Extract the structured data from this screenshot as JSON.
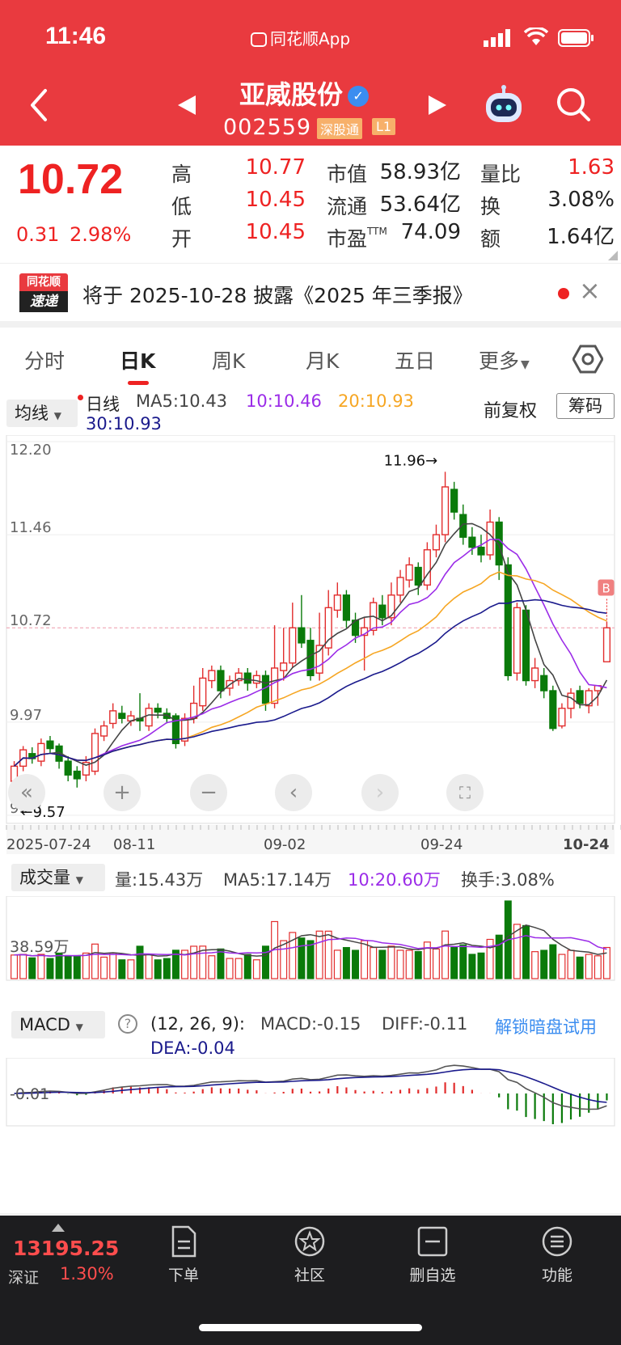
{
  "status": {
    "time": "11:46",
    "app": "同花顺App"
  },
  "stock": {
    "name": "亚威股份",
    "code": "002559",
    "badge1": "深股通",
    "badge2": "L1"
  },
  "quote": {
    "price": "10.72",
    "change": "0.31",
    "change_pct": "2.98%",
    "high_label": "高",
    "high": "10.77",
    "low_label": "低",
    "low": "10.45",
    "open_label": "开",
    "open": "10.45",
    "mcap_label": "市值",
    "mcap": "58.93亿",
    "float_label": "流通",
    "float": "53.64亿",
    "pe_label": "市盈",
    "pe_sup": "TTM",
    "pe": "74.09",
    "vr_label": "量比",
    "vr": "1.63",
    "turn_label": "换",
    "turn": "3.08%",
    "amt_label": "额",
    "amt": "1.64亿"
  },
  "notice": {
    "brand_top": "同花顺",
    "brand_bottom": "速递",
    "text": "将于 2025-10-28 披露《2025 年三季报》",
    "close": "×"
  },
  "tabs": [
    "分时",
    "日K",
    "周K",
    "月K",
    "五日",
    "更多"
  ],
  "kline": {
    "indicator": "均线",
    "period": "日线",
    "ma5": "MA5:10.43",
    "ma10": "10:10.46",
    "ma20": "20:10.93",
    "ma30": "30:10.93",
    "adjust": "前复权",
    "chips": "筹码",
    "y_labels": [
      "12.20",
      "11.46",
      "10.72",
      "9.97",
      "9.23"
    ],
    "high_mark": "11.96→",
    "low_mark": "←9.57",
    "buy_mark": "B",
    "x_labels": [
      "2025-07-24",
      "08-11",
      "09-02",
      "09-24",
      "10-24"
    ]
  },
  "volume": {
    "indicator": "成交量",
    "vol": "量:15.43万",
    "ma5": "MA5:17.14万",
    "ma10": "10:20.60万",
    "turnover": "换手:3.08%",
    "y_label": "38.59万"
  },
  "macd": {
    "indicator": "MACD",
    "help": "?",
    "params": "(12, 26, 9):",
    "macd": "MACD:-0.15",
    "diff": "DIFF:-0.11",
    "dea": "DEA:-0.04",
    "unlock": "解锁暗盘试用",
    "y_label": "-0.01"
  },
  "colors": {
    "up": "#e22d2d",
    "down": "#0a7a0a",
    "ma5": "#444444",
    "ma10": "#9b2ce8",
    "ma20": "#f6a623",
    "ma30": "#1a1a8c",
    "brand": "#e93a3f"
  },
  "bottom": {
    "index_value": "13195.25",
    "index_name": "深证",
    "index_pct": "1.30%",
    "nav": [
      "下单",
      "社区",
      "删自选",
      "功能"
    ]
  },
  "chart_data": {
    "type": "candlestick",
    "x_range": [
      "2025-07-24",
      "2025-10-24"
    ],
    "ylim": [
      9.23,
      12.2
    ],
    "annotations": {
      "high": 11.96,
      "low": 9.57
    },
    "candles": [
      [
        9.5,
        9.62,
        9.45,
        9.66
      ],
      [
        9.62,
        9.75,
        9.58,
        9.78
      ],
      [
        9.72,
        9.68,
        9.64,
        9.77
      ],
      [
        9.66,
        9.8,
        9.62,
        9.84
      ],
      [
        9.82,
        9.76,
        9.72,
        9.86
      ],
      [
        9.78,
        9.66,
        9.6,
        9.8
      ],
      [
        9.66,
        9.55,
        9.5,
        9.7
      ],
      [
        9.58,
        9.52,
        9.45,
        9.62
      ],
      [
        9.55,
        9.65,
        9.5,
        9.7
      ],
      [
        9.58,
        9.88,
        9.55,
        9.92
      ],
      [
        9.86,
        9.94,
        9.82,
        9.98
      ],
      [
        9.96,
        10.06,
        9.92,
        10.12
      ],
      [
        10.04,
        10.0,
        9.96,
        10.1
      ],
      [
        9.98,
        10.02,
        9.94,
        10.06
      ],
      [
        10.0,
        9.98,
        9.9,
        10.2
      ],
      [
        9.94,
        10.08,
        9.9,
        10.12
      ],
      [
        10.08,
        10.05,
        10.0,
        10.12
      ],
      [
        10.04,
        10.0,
        9.96,
        10.08
      ],
      [
        10.02,
        9.8,
        9.76,
        10.04
      ],
      [
        9.82,
        10.0,
        9.78,
        10.04
      ],
      [
        10.0,
        10.12,
        9.96,
        10.26
      ],
      [
        10.1,
        10.32,
        10.06,
        10.4
      ],
      [
        10.3,
        10.38,
        10.24,
        10.42
      ],
      [
        10.38,
        10.22,
        10.16,
        10.42
      ],
      [
        10.24,
        10.3,
        10.18,
        10.34
      ],
      [
        10.3,
        10.36,
        10.26,
        10.4
      ],
      [
        10.36,
        10.28,
        10.22,
        10.4
      ],
      [
        10.28,
        10.34,
        10.24,
        10.38
      ],
      [
        10.34,
        10.12,
        10.06,
        10.38
      ],
      [
        10.12,
        10.4,
        10.08,
        10.74
      ],
      [
        10.38,
        10.44,
        10.3,
        10.72
      ],
      [
        10.44,
        10.72,
        10.4,
        10.92
      ],
      [
        10.72,
        10.6,
        10.56,
        10.98
      ],
      [
        10.62,
        10.34,
        10.3,
        10.72
      ],
      [
        10.36,
        10.58,
        10.3,
        10.84
      ],
      [
        10.56,
        10.88,
        10.5,
        11.02
      ],
      [
        10.86,
        10.98,
        10.8,
        11.08
      ],
      [
        10.98,
        10.78,
        10.72,
        11.02
      ],
      [
        10.78,
        10.66,
        10.6,
        10.84
      ],
      [
        10.66,
        10.72,
        10.38,
        10.8
      ],
      [
        10.7,
        10.92,
        10.66,
        10.96
      ],
      [
        10.9,
        10.8,
        10.74,
        10.98
      ],
      [
        10.8,
        10.98,
        10.74,
        11.08
      ],
      [
        10.98,
        11.12,
        10.92,
        11.18
      ],
      [
        11.1,
        11.22,
        11.04,
        11.28
      ],
      [
        11.2,
        11.06,
        10.98,
        11.24
      ],
      [
        11.06,
        11.34,
        11.02,
        11.4
      ],
      [
        11.34,
        11.46,
        11.28,
        11.54
      ],
      [
        11.46,
        11.84,
        11.4,
        11.96
      ],
      [
        11.82,
        11.64,
        11.58,
        11.88
      ],
      [
        11.62,
        11.44,
        11.38,
        11.7
      ],
      [
        11.44,
        11.36,
        11.3,
        11.52
      ],
      [
        11.36,
        11.3,
        11.24,
        11.46
      ],
      [
        11.3,
        11.56,
        11.26,
        11.66
      ],
      [
        11.56,
        11.22,
        11.1,
        11.6
      ],
      [
        11.22,
        10.34,
        10.3,
        11.28
      ],
      [
        10.36,
        10.88,
        10.3,
        10.92
      ],
      [
        10.86,
        10.3,
        10.26,
        10.9
      ],
      [
        10.3,
        10.4,
        10.24,
        10.48
      ],
      [
        10.34,
        10.22,
        10.16,
        10.4
      ],
      [
        10.22,
        9.92,
        9.9,
        10.26
      ],
      [
        9.94,
        10.08,
        9.92,
        10.12
      ],
      [
        10.08,
        10.2,
        10.0,
        10.24
      ],
      [
        10.22,
        10.12,
        10.08,
        10.26
      ],
      [
        10.1,
        10.22,
        10.04,
        10.24
      ],
      [
        10.22,
        10.26,
        10.1,
        10.26
      ],
      [
        10.45,
        10.72,
        10.45,
        10.77
      ]
    ]
  }
}
